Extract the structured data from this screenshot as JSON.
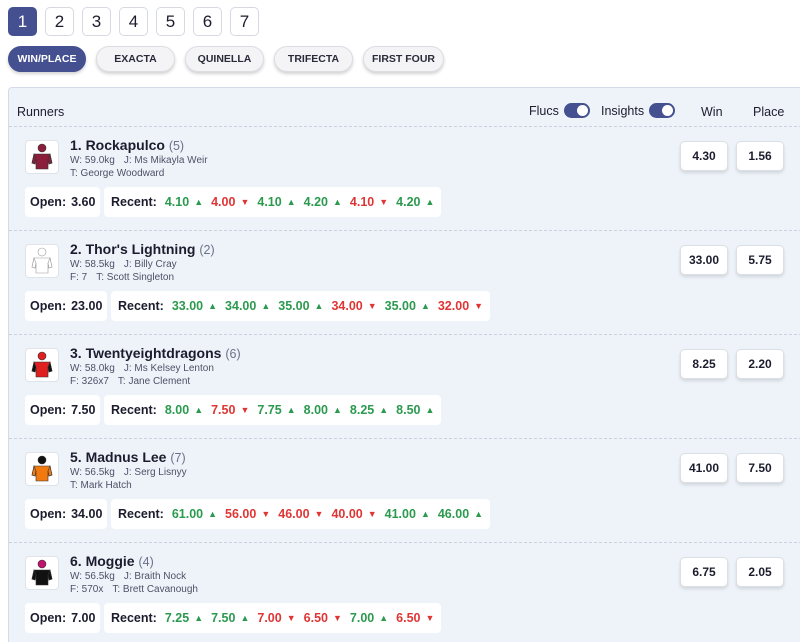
{
  "races": [
    "1",
    "2",
    "3",
    "4",
    "5",
    "6",
    "7"
  ],
  "active_race": 0,
  "bet_types": [
    "WIN/PLACE",
    "EXACTA",
    "QUINELLA",
    "TRIFECTA",
    "FIRST FOUR"
  ],
  "header": {
    "runners_label": "Runners",
    "flucs_label": "Flucs",
    "insights_label": "Insights",
    "win_label": "Win",
    "place_label": "Place"
  },
  "colors": {
    "accent": "#44508f",
    "up": "#2b9a4f",
    "down": "#e03535"
  },
  "icons": {
    "up": "triangle-up-icon",
    "down": "triangle-down-icon"
  },
  "runners": [
    {
      "name": "1. Rockapulco",
      "barrier": "(5)",
      "meta1": [
        "W: 59.0kg",
        "J: Ms Mikayla Weir"
      ],
      "meta2": [
        "T: George Woodward"
      ],
      "win": "4.30",
      "place": "1.56",
      "open_label": "Open:",
      "open": "3.60",
      "recent_label": "Recent:",
      "recent": [
        {
          "v": "4.10",
          "d": "up"
        },
        {
          "v": "4.00",
          "d": "down"
        },
        {
          "v": "4.10",
          "d": "up"
        },
        {
          "v": "4.20",
          "d": "up"
        },
        {
          "v": "4.10",
          "d": "down"
        },
        {
          "v": "4.20",
          "d": "up"
        }
      ],
      "silk": {
        "body": "#8b1f3b",
        "cap": "#8b1f3b",
        "sleeve": "#8b1f3b"
      }
    },
    {
      "name": "2. Thor's Lightning",
      "barrier": "(2)",
      "meta1": [
        "W: 58.5kg",
        "J: Billy Cray"
      ],
      "meta2": [
        "F: 7",
        "T: Scott Singleton"
      ],
      "win": "33.00",
      "place": "5.75",
      "open_label": "Open:",
      "open": "23.00",
      "recent_label": "Recent:",
      "recent": [
        {
          "v": "33.00",
          "d": "up"
        },
        {
          "v": "34.00",
          "d": "up"
        },
        {
          "v": "35.00",
          "d": "up"
        },
        {
          "v": "34.00",
          "d": "down"
        },
        {
          "v": "35.00",
          "d": "up"
        },
        {
          "v": "32.00",
          "d": "down"
        }
      ],
      "silk": {
        "body": "#ffffff",
        "cap": "#ffffff",
        "sleeve": "#ffffff"
      }
    },
    {
      "name": "3. Twentyeightdragons",
      "barrier": "(6)",
      "meta1": [
        "W: 58.0kg",
        "J: Ms Kelsey Lenton"
      ],
      "meta2": [
        "F: 326x7",
        "T: Jane Clement"
      ],
      "win": "8.25",
      "place": "2.20",
      "open_label": "Open:",
      "open": "7.50",
      "recent_label": "Recent:",
      "recent": [
        {
          "v": "8.00",
          "d": "up"
        },
        {
          "v": "7.50",
          "d": "down"
        },
        {
          "v": "7.75",
          "d": "up"
        },
        {
          "v": "8.00",
          "d": "up"
        },
        {
          "v": "8.25",
          "d": "up"
        },
        {
          "v": "8.50",
          "d": "up"
        }
      ],
      "silk": {
        "body": "#e02020",
        "cap": "#e02020",
        "sleeve": "#111111"
      }
    },
    {
      "name": "5. Madnus Lee",
      "barrier": "(7)",
      "meta1": [
        "W: 56.5kg",
        "J: Serg Lisnyy"
      ],
      "meta2": [
        "T: Mark Hatch"
      ],
      "win": "41.00",
      "place": "7.50",
      "open_label": "Open:",
      "open": "34.00",
      "recent_label": "Recent:",
      "recent": [
        {
          "v": "61.00",
          "d": "up"
        },
        {
          "v": "56.00",
          "d": "down"
        },
        {
          "v": "46.00",
          "d": "down"
        },
        {
          "v": "40.00",
          "d": "down"
        },
        {
          "v": "41.00",
          "d": "up"
        },
        {
          "v": "46.00",
          "d": "up"
        }
      ],
      "silk": {
        "body": "#f07a10",
        "cap": "#111111",
        "sleeve": "#f07a10"
      }
    },
    {
      "name": "6. Moggie",
      "barrier": "(4)",
      "meta1": [
        "W: 56.5kg",
        "J: Braith Nock"
      ],
      "meta2": [
        "F: 570x",
        "T: Brett Cavanough"
      ],
      "win": "6.75",
      "place": "2.05",
      "open_label": "Open:",
      "open": "7.00",
      "recent_label": "Recent:",
      "recent": [
        {
          "v": "7.25",
          "d": "up"
        },
        {
          "v": "7.50",
          "d": "up"
        },
        {
          "v": "7.00",
          "d": "down"
        },
        {
          "v": "6.50",
          "d": "down"
        },
        {
          "v": "7.00",
          "d": "up"
        },
        {
          "v": "6.50",
          "d": "down"
        }
      ],
      "silk": {
        "body": "#111111",
        "cap": "#c0126a",
        "sleeve": "#111111"
      }
    }
  ]
}
